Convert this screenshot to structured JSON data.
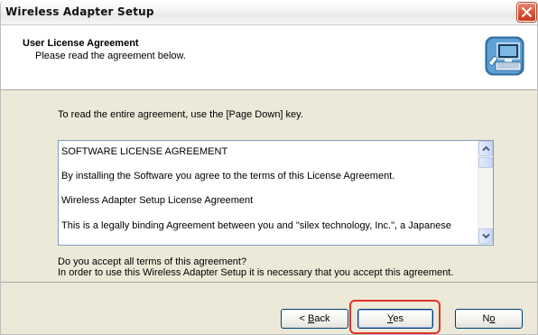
{
  "window": {
    "title": "Wireless Adapter Setup",
    "close_icon": "close-x-icon"
  },
  "header": {
    "title": "User License Agreement",
    "subtitle": "Please read the agreement below.",
    "icon": "computer-setup-icon"
  },
  "body": {
    "instruction": "To read the entire agreement, use the [Page Down] key.",
    "license_lines": [
      "SOFTWARE LICENSE AGREEMENT",
      "By installing the Software you agree to the terms of this License Agreement.",
      "Wireless Adapter Setup License Agreement",
      "This is a legally binding Agreement between you and \"silex technology, Inc.\", a Japanese"
    ],
    "question": "Do you accept all terms of this agreement?",
    "requirement": "In order to use this Wireless Adapter Setup it is necessary that you accept this agreement."
  },
  "buttons": {
    "back_prefix": "< ",
    "back_mnemonic": "B",
    "back_rest": "ack",
    "yes_mnemonic": "Y",
    "yes_rest": "es",
    "no_first": "N",
    "no_mnemonic": "o"
  },
  "colors": {
    "highlight": "#e0322b",
    "dialog_bg": "#ece9d8"
  }
}
